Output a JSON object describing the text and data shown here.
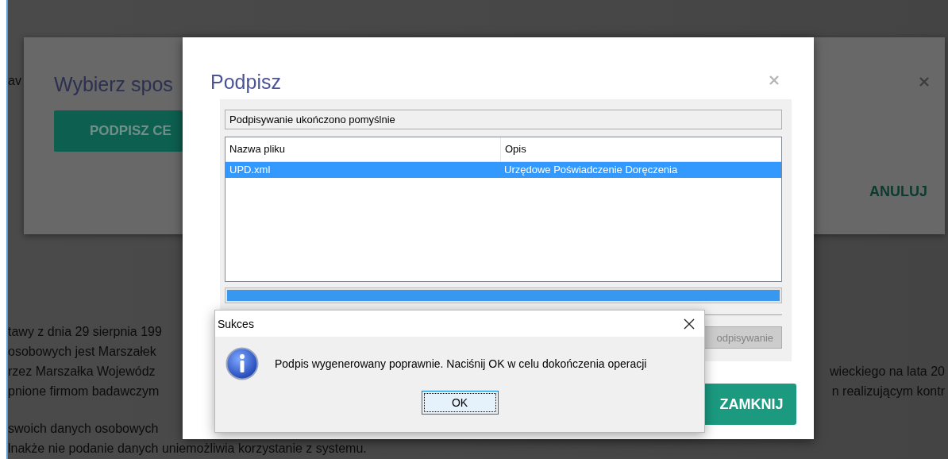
{
  "background_page": {
    "top_text": "av",
    "paragraphs": [
      [
        {
          "left": "tawy z dnia 29 sierpnia 199"
        },
        {
          "left": "osobowych jest Marszałek"
        },
        {
          "left": "rzez Marszałka Wojewódz",
          "right": "wieckiego na lata 20"
        },
        {
          "left": "pnione firmom badawczym",
          "right": "n realizującym kontr"
        }
      ],
      [
        {
          "left": "swoich danych osobowych"
        },
        {
          "left": "lnakże nie podanie danych uniemożliwia korzystanie z systemu."
        }
      ]
    ]
  },
  "choose_dialog": {
    "title": "Wybierz spos",
    "sign_button": "PODPISZ CE",
    "cancel_button": "ANULUJ"
  },
  "sign_dialog": {
    "title": "Podpisz",
    "status": "Podpisywanie ukończono pomyślnie",
    "table": {
      "columns": [
        "Nazwa pliku",
        "Opis"
      ],
      "rows": [
        {
          "cells": [
            "UPD.xml",
            "Urzędowe Poświadczenie Doręczenia"
          ],
          "selected": true
        }
      ]
    },
    "progress": {
      "level": 1
    },
    "sign_button": {
      "label": "odpisywanie",
      "disabled": true
    },
    "close_button": "ZAMKNIJ"
  },
  "message_box": {
    "title": "Sukces",
    "message": "Podpis wygenerowany poprawnie. Naciśnij OK w celu dokończenia operacji",
    "ok_button": "OK"
  }
}
